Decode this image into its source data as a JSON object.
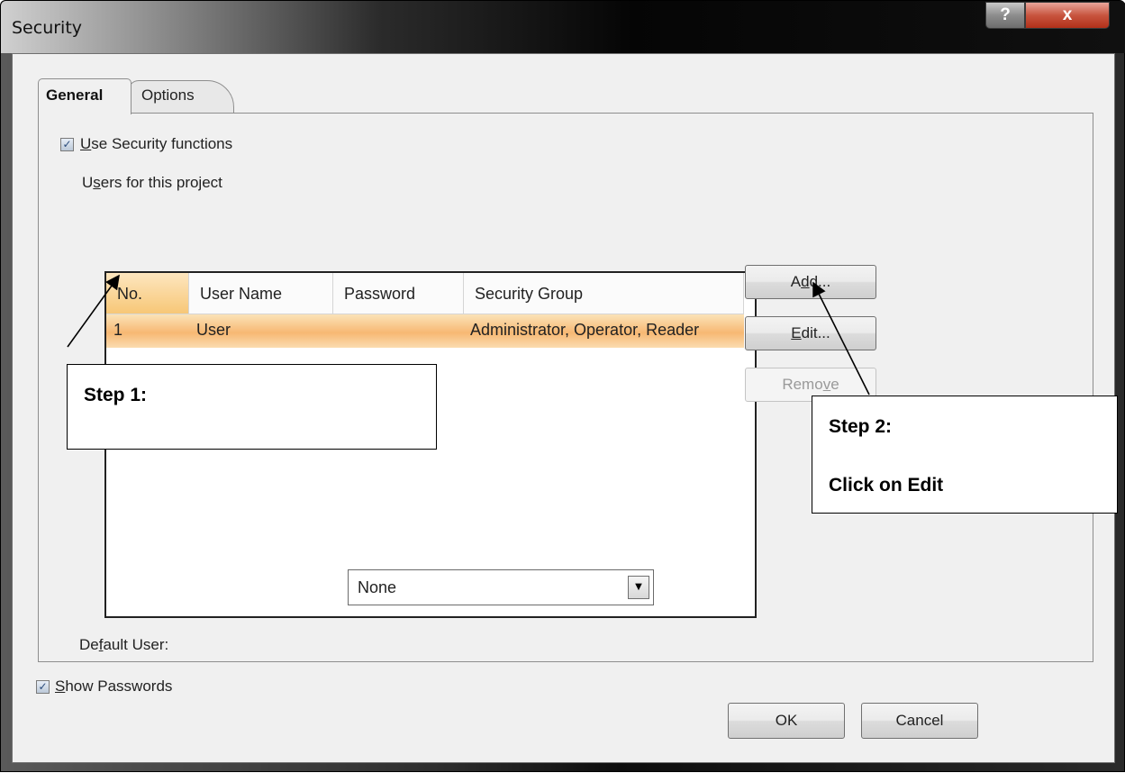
{
  "window": {
    "title": "Security",
    "help_button": "?",
    "close_button": "x"
  },
  "tabs": [
    {
      "label": "General",
      "active": true
    },
    {
      "label": "Options",
      "active": false
    }
  ],
  "general": {
    "use_security_label": "Use Security functions",
    "use_security_checked": true,
    "users_label": "Users for this project",
    "columns": [
      "No.",
      "User Name",
      "Password",
      "Security Group"
    ],
    "rows": [
      {
        "no": "1",
        "user_name": "User",
        "password": "",
        "security_group": "Administrator, Operator, Reader",
        "selected": true
      }
    ],
    "buttons": {
      "add": "Add...",
      "edit": "Edit...",
      "remove": "Remove"
    },
    "default_user_label": "Default User:",
    "default_user_value": "None"
  },
  "footer": {
    "show_passwords_label": "Show Passwords",
    "show_passwords_checked": true,
    "ok_label": "OK",
    "cancel_label": "Cancel"
  },
  "annotations": {
    "step1_title": "Step 1:",
    "step2_title": "Step 2:",
    "step2_text": "Click on Edit"
  },
  "colors": {
    "selection": "#f7b873",
    "sorted_header": "#f7c777",
    "close_button": "#c8553f"
  }
}
